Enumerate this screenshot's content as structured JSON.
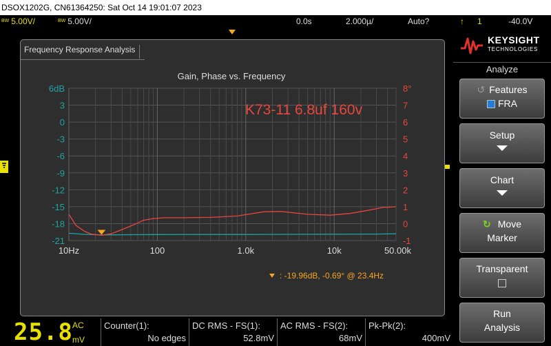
{
  "window_title": "DSOX1202G, CN61364250: Sat Oct 14 19:01:07 2023",
  "status_bar": {
    "ch1_bw": "BW",
    "ch1_scale": "5.00V/",
    "ch2_bw": "BW",
    "ch2_scale": "5.00V/",
    "time_delay": "0.0s",
    "time_scale": "2.000µ/",
    "trigger_mode": "Auto?",
    "trigger_source": "1",
    "trigger_level": "-40.0V"
  },
  "fra": {
    "title": "Frequency Response Analysis",
    "annotation": "K73-11 6.8uf 160v",
    "marker_readout": ":  -19.96dB, -0.69° @ 23.4Hz"
  },
  "colors": {
    "gain": "#1fa3a3",
    "phase": "#e8463e",
    "marker": "#f5a623",
    "ch1": "#e8e000"
  },
  "chart_data": {
    "type": "line",
    "title": "Gain, Phase vs. Frequency",
    "x_scale": "log",
    "xlim": [
      10,
      50000
    ],
    "x_ticks": [
      {
        "value": 10,
        "label": "10Hz"
      },
      {
        "value": 100,
        "label": "100"
      },
      {
        "value": 1000,
        "label": "1.0k"
      },
      {
        "value": 10000,
        "label": "10k"
      },
      {
        "value": 50000,
        "label": "50.00k"
      }
    ],
    "y_left": {
      "label": "Gain",
      "ylim": [
        -21,
        6
      ],
      "ticks": [
        "6dB",
        "3",
        "0",
        "-3",
        "-6",
        "-9",
        "-12",
        "-15",
        "-18",
        "-21"
      ],
      "tick_values": [
        6,
        3,
        0,
        -3,
        -6,
        -9,
        -12,
        -15,
        -18,
        -21
      ]
    },
    "y_right": {
      "label": "Phase",
      "ylim": [
        -1,
        8
      ],
      "ticks": [
        "8°",
        "7",
        "6",
        "5",
        "4",
        "3",
        "2",
        "1",
        "0",
        "-1"
      ],
      "tick_values": [
        8,
        7,
        6,
        5,
        4,
        3,
        2,
        1,
        0,
        -1
      ]
    },
    "grid": true,
    "series": [
      {
        "axis": "left",
        "x": [
          10,
          15,
          23.4,
          50,
          100,
          300,
          1000,
          3000,
          10000,
          30000,
          50000
        ],
        "y": [
          -19.7,
          -19.9,
          -20.0,
          -19.96,
          -19.94,
          -19.93,
          -19.92,
          -19.9,
          -19.88,
          -19.85,
          -19.8
        ]
      },
      {
        "axis": "right",
        "x": [
          10,
          12,
          15,
          18,
          23.4,
          30,
          40,
          55,
          70,
          90,
          120,
          200,
          400,
          800,
          1600,
          2500,
          5000,
          9000,
          15000,
          25000,
          35000,
          50000
        ],
        "y": [
          0.55,
          -0.1,
          -0.45,
          -0.62,
          -0.69,
          -0.6,
          -0.35,
          -0.05,
          0.2,
          0.3,
          0.35,
          0.35,
          0.37,
          0.45,
          0.7,
          0.72,
          0.55,
          0.5,
          0.6,
          0.8,
          0.95,
          1.0
        ]
      }
    ],
    "marker": {
      "x": 23.4,
      "gain": -19.96,
      "phase": -0.69
    }
  },
  "softkeys": {
    "brand_name": "KEYSIGHT",
    "brand_sub": "TECHNOLOGIES",
    "menu_title": "Analyze",
    "features": "Features",
    "features_value": "FRA",
    "setup": "Setup",
    "chart": "Chart",
    "move_marker_1": "Move",
    "move_marker_2": "Marker",
    "transparent": "Transparent",
    "run_1": "Run",
    "run_2": "Analysis"
  },
  "measurements": {
    "big_value": "25.8",
    "coupling": "AC",
    "unit": "mV",
    "counter_label": "Counter(1):",
    "counter_value": "No edges",
    "dc_rms_label": "DC RMS - FS(1):",
    "dc_rms_value": "52.8mV",
    "ac_rms_label": "AC RMS - FS(2):",
    "ac_rms_value": "68mV",
    "pkpk_label": "Pk-Pk(2):",
    "pkpk_value": "400mV"
  }
}
